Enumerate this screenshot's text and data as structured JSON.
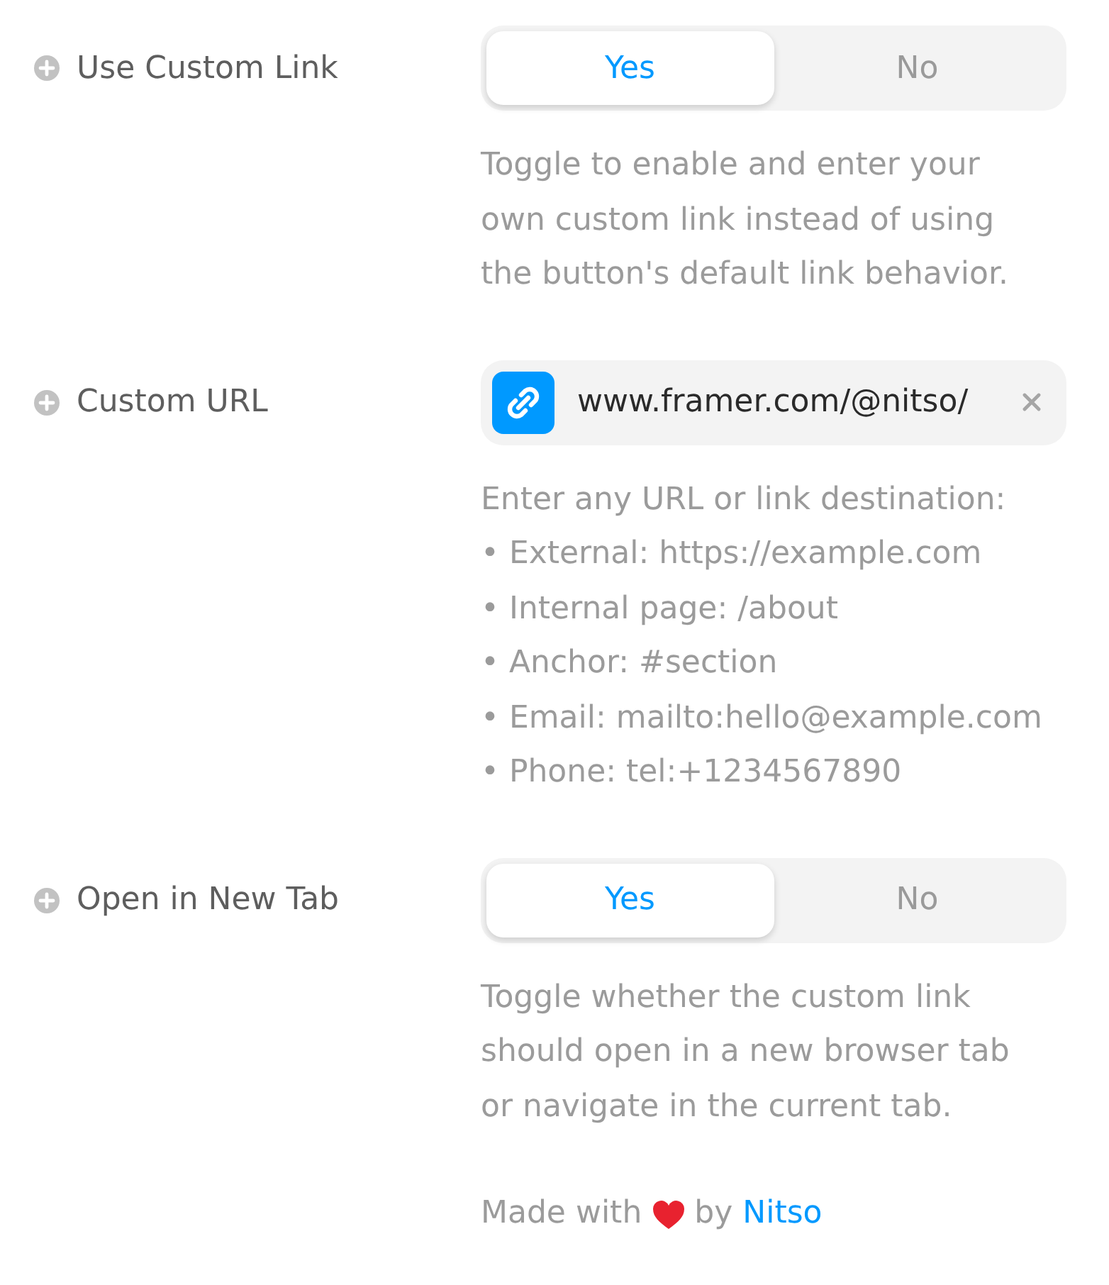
{
  "properties": [
    {
      "kind": "toggle",
      "label": "Use Custom Link",
      "options": [
        {
          "label": "Yes",
          "selected": true
        },
        {
          "label": "No",
          "selected": false
        }
      ],
      "description": "Toggle to enable and enter your own custom link instead of using the button's default link behavior."
    },
    {
      "kind": "link",
      "label": "Custom URL",
      "value": "www.framer.com/@nitso/",
      "description": "Enter any URL or link destination:",
      "bullets": [
        "• External: https://example.com",
        "• Internal page: /about",
        "• Anchor: #section",
        "• Email: mailto:hello@example.com",
        "• Phone: tel:+1234567890"
      ]
    },
    {
      "kind": "toggle",
      "label": "Open in New Tab",
      "options": [
        {
          "label": "Yes",
          "selected": true
        },
        {
          "label": "No",
          "selected": false
        }
      ],
      "description": "Toggle whether the custom link should open in a new browser tab or navigate in the current tab."
    }
  ],
  "footer": {
    "text_before": "Made with",
    "text_after": "by",
    "link": "Nitso"
  }
}
